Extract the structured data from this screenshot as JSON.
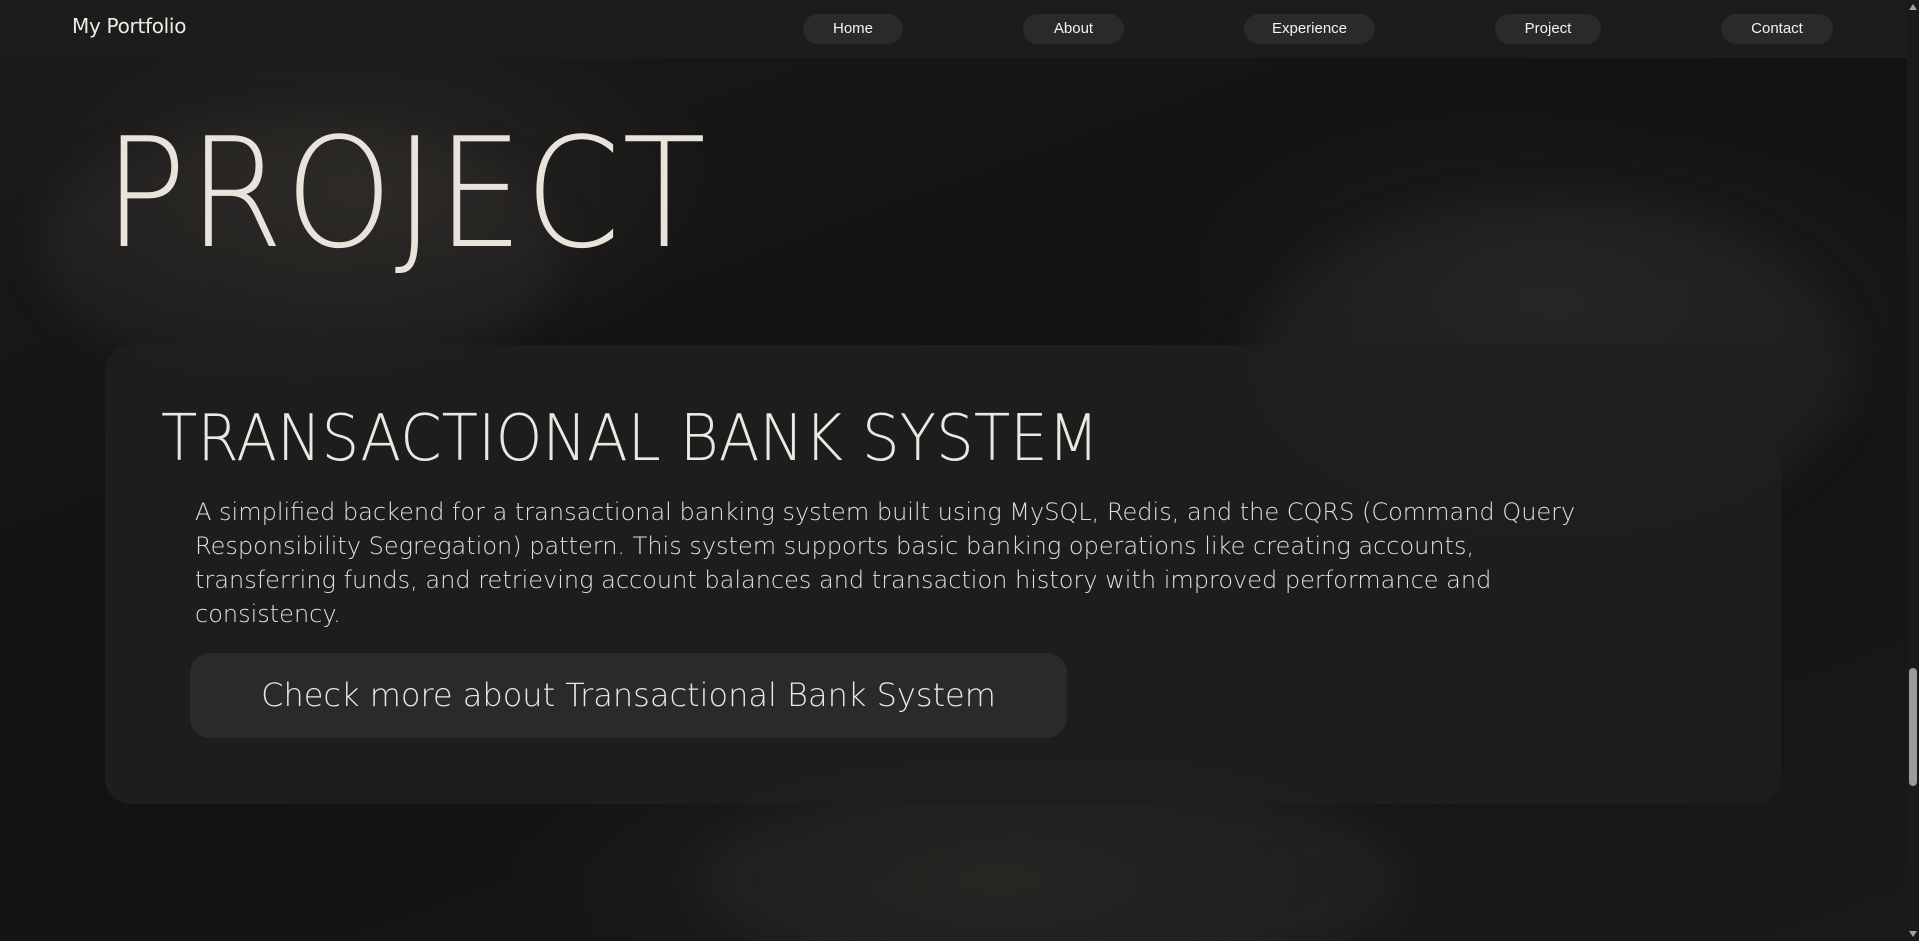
{
  "nav": {
    "brand": "My Portfolio",
    "items": [
      {
        "label": "Home"
      },
      {
        "label": "About"
      },
      {
        "label": "Experience"
      },
      {
        "label": "Project"
      },
      {
        "label": "Contact"
      }
    ]
  },
  "main": {
    "title": "PROJECT",
    "project": {
      "title": "TRANSACTIONAL BANK SYSTEM",
      "description": "A simplified backend for a transactional banking system built using MySQL, Redis, and the CQRS (Command Query Responsibility Segregation) pattern. This system supports basic banking operations like creating accounts, transferring funds, and retrieving account balances and transaction history with improved performance and consistency.",
      "link_label": "Check more about Transactional Bank System"
    }
  },
  "colors": {
    "background": "#151515",
    "navbar": "#1c1c1c",
    "button": "#2a2a2a",
    "card": "#1e1e1e",
    "text": "#e8e4dc"
  }
}
